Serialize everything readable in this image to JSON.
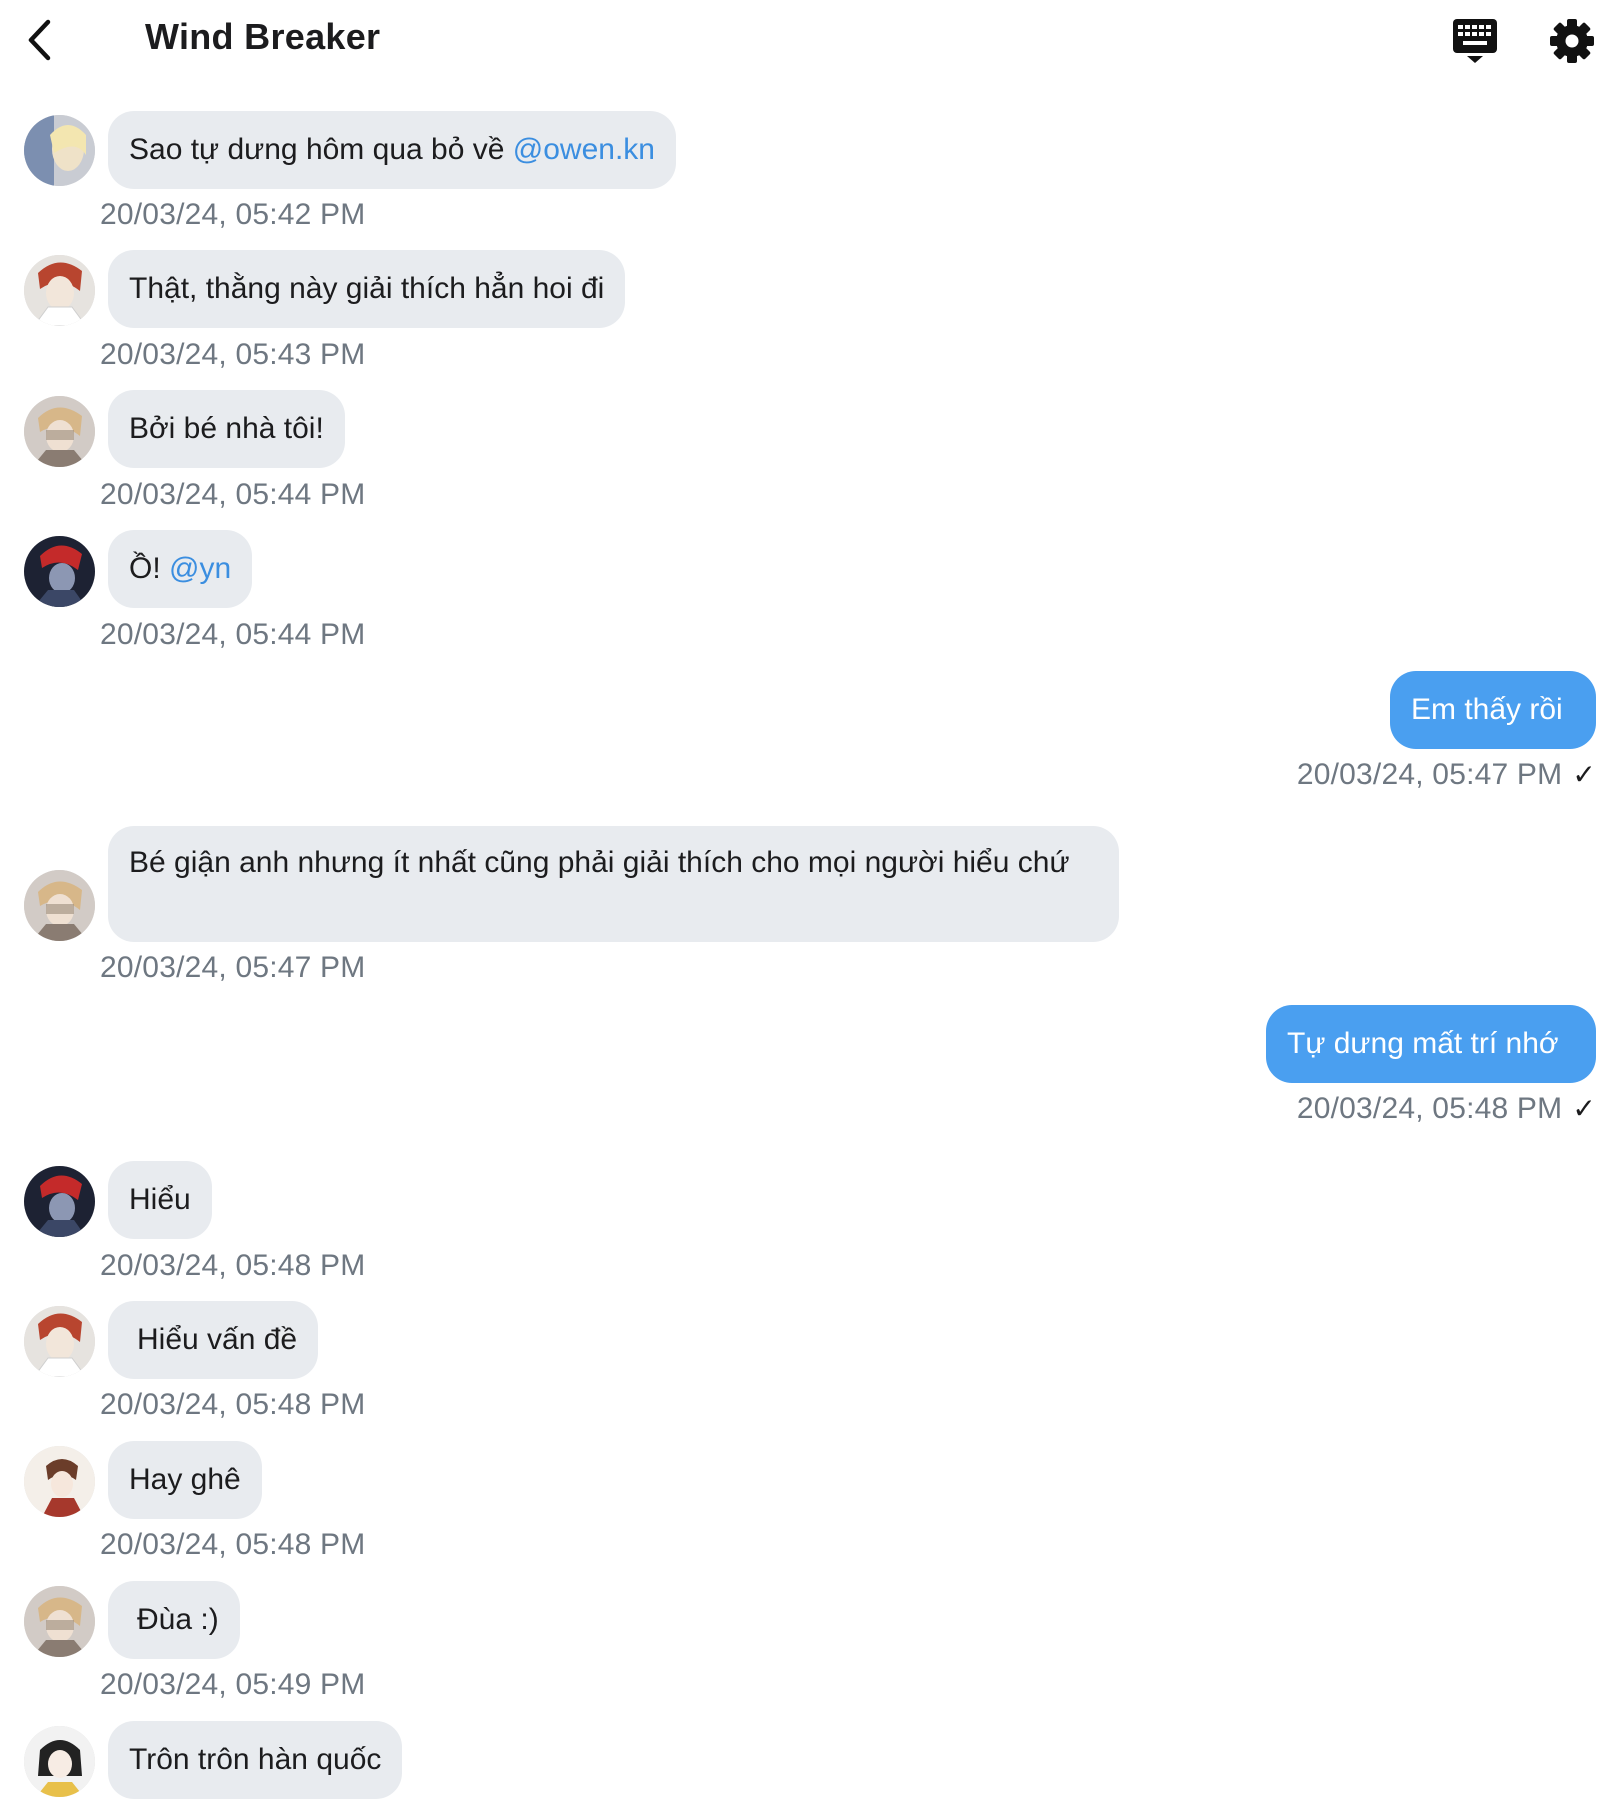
{
  "header": {
    "title": "Wind Breaker",
    "icons": [
      "back-arrow-icon",
      "keyboard-icon",
      "gear-icon"
    ]
  },
  "colors": {
    "incoming_bubble": "#e8ebef",
    "outgoing_bubble": "#4a9ff0",
    "mention": "#3b8ee0",
    "timestamp": "#6e7781"
  },
  "messages": [
    {
      "direction": "in",
      "text": "Sao tự dưng hôm qua bỏ về ",
      "mention": "@owen.kn",
      "time": "20/03/24, 05:42 PM"
    },
    {
      "direction": "in",
      "text": "Thật, thằng này giải thích hẳn hoi đi",
      "time": "20/03/24, 05:43 PM"
    },
    {
      "direction": "in",
      "text": "Bởi bé nhà tôi!",
      "time": "20/03/24, 05:44 PM"
    },
    {
      "direction": "in",
      "text": "Ồ! ",
      "mention": "@yn",
      "time": "20/03/24, 05:44 PM"
    },
    {
      "direction": "out",
      "text": "Em thấy rồi",
      "time": "20/03/24, 05:47 PM",
      "status": "✓"
    },
    {
      "direction": "in",
      "text": "Bé giận anh nhưng ít nhất cũng phải giải thích cho mọi người hiểu chứ",
      "time": "20/03/24, 05:47 PM"
    },
    {
      "direction": "out",
      "text": "Tự dưng mất trí nhớ",
      "time": "20/03/24, 05:48 PM",
      "status": "✓"
    },
    {
      "direction": "in",
      "text": "Hiểu",
      "time": "20/03/24, 05:48 PM"
    },
    {
      "direction": "in",
      "text": "Hiểu vấn đề",
      "time": "20/03/24, 05:48 PM"
    },
    {
      "direction": "in",
      "text": "Hay ghê",
      "time": "20/03/24, 05:48 PM"
    },
    {
      "direction": "in",
      "text": "Đùa :)",
      "time": "20/03/24, 05:49 PM"
    },
    {
      "direction": "in",
      "text": "Trôn trôn hàn quốc"
    }
  ]
}
